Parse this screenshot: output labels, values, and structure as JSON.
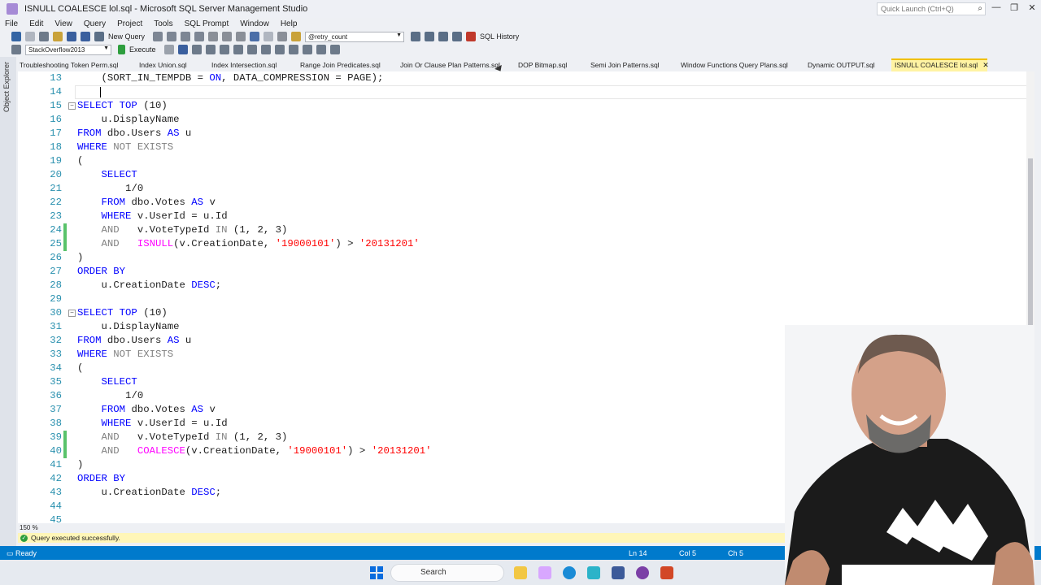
{
  "window": {
    "title": "ISNULL COALESCE lol.sql - Microsoft SQL Server Management Studio",
    "quick_launch_placeholder": "Quick Launch (Ctrl+Q)"
  },
  "menu": [
    "File",
    "Edit",
    "View",
    "Query",
    "Project",
    "Tools",
    "SQL Prompt",
    "Window",
    "Help"
  ],
  "toolbar": {
    "new_query": "New Query",
    "search_combo": "@retry_count",
    "sql_history": "SQL History",
    "database": "StackOverflow2013",
    "execute": "Execute"
  },
  "sidebar": {
    "object_explorer": "Object Explorer"
  },
  "tabs": [
    "Troubleshooting Token Perm.sql",
    "Index Union.sql",
    "Index Intersection.sql",
    "Range Join Predicates.sql",
    "Join Or Clause Plan Patterns.sql",
    "DOP Bitmap.sql",
    "Semi Join Patterns.sql",
    "Window Functions Query Plans.sql",
    "Dynamic OUTPUT.sql",
    "ISNULL COALESCE lol.sql"
  ],
  "active_tab_close": "✕",
  "editor": {
    "zoom": "150 %",
    "lines": [
      {
        "n": "13",
        "text": "    (SORT_IN_TEMPDB = ON, DATA_COMPRESSION = PAGE);"
      },
      {
        "n": "14",
        "text": ""
      },
      {
        "n": "15",
        "text": "SELECT TOP (10)"
      },
      {
        "n": "16",
        "text": "    u.DisplayName"
      },
      {
        "n": "17",
        "text": "FROM dbo.Users AS u"
      },
      {
        "n": "18",
        "text": "WHERE NOT EXISTS"
      },
      {
        "n": "19",
        "text": "("
      },
      {
        "n": "20",
        "text": "    SELECT"
      },
      {
        "n": "21",
        "text": "        1/0"
      },
      {
        "n": "22",
        "text": "    FROM dbo.Votes AS v"
      },
      {
        "n": "23",
        "text": "    WHERE v.UserId = u.Id"
      },
      {
        "n": "24",
        "text": "    AND   v.VoteTypeId IN (1, 2, 3)"
      },
      {
        "n": "25",
        "text": "    AND   ISNULL(v.CreationDate, '19000101') > '20131201'"
      },
      {
        "n": "26",
        "text": ")"
      },
      {
        "n": "27",
        "text": "ORDER BY"
      },
      {
        "n": "28",
        "text": "    u.CreationDate DESC;"
      },
      {
        "n": "29",
        "text": ""
      },
      {
        "n": "30",
        "text": "SELECT TOP (10)"
      },
      {
        "n": "31",
        "text": "    u.DisplayName"
      },
      {
        "n": "32",
        "text": "FROM dbo.Users AS u"
      },
      {
        "n": "33",
        "text": "WHERE NOT EXISTS"
      },
      {
        "n": "34",
        "text": "("
      },
      {
        "n": "35",
        "text": "    SELECT"
      },
      {
        "n": "36",
        "text": "        1/0"
      },
      {
        "n": "37",
        "text": "    FROM dbo.Votes AS v"
      },
      {
        "n": "38",
        "text": "    WHERE v.UserId = u.Id"
      },
      {
        "n": "39",
        "text": "    AND   v.VoteTypeId IN (1, 2, 3)"
      },
      {
        "n": "40",
        "text": "    AND   COALESCE(v.CreationDate, '19000101') > '20131201'"
      },
      {
        "n": "41",
        "text": ")"
      },
      {
        "n": "42",
        "text": "ORDER BY"
      },
      {
        "n": "43",
        "text": "    u.CreationDate DESC;"
      },
      {
        "n": "44",
        "text": ""
      },
      {
        "n": "45",
        "text": ""
      }
    ]
  },
  "status": {
    "message": "Query executed successfully.",
    "ready": "Ready",
    "ln": "Ln 14",
    "col": "Col 5",
    "ch": "Ch 5"
  },
  "taskbar": {
    "search": "Search"
  },
  "colors": {
    "statusbar": "#007acc",
    "active_tab": "#fff3a3",
    "keyword": "#0000ff",
    "string": "#ff0000",
    "function": "#ff00ff",
    "line_number": "#2b91af"
  }
}
